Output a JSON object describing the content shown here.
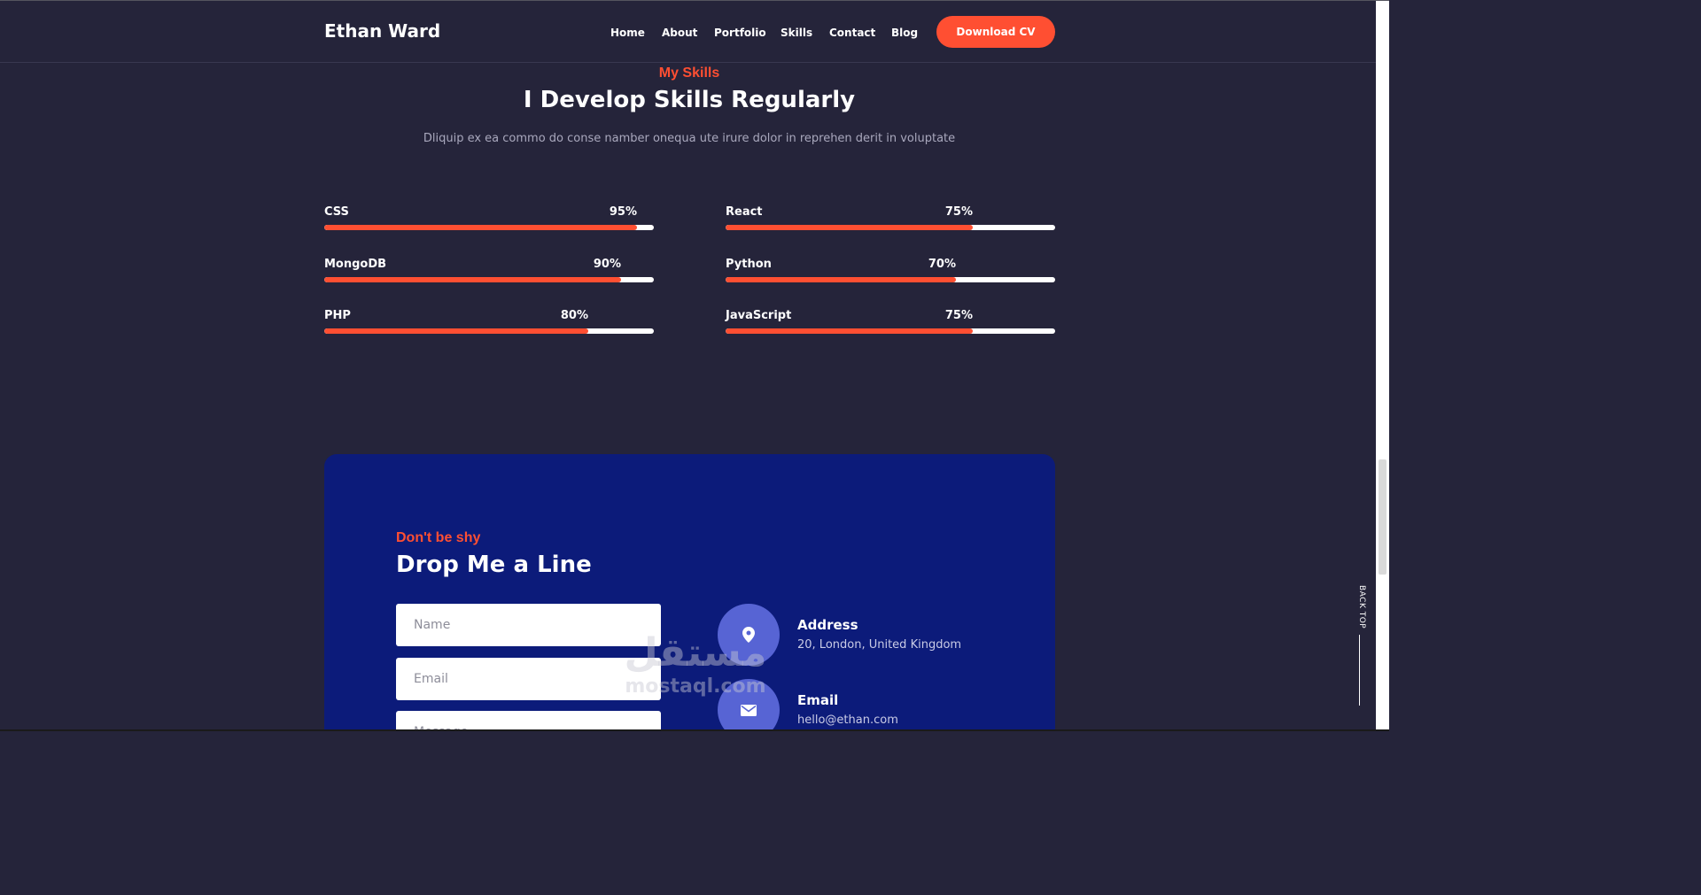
{
  "header": {
    "logo": "Ethan Ward",
    "nav": [
      {
        "label": "Home"
      },
      {
        "label": "About"
      },
      {
        "label": "Portfolio"
      },
      {
        "label": "Skills"
      },
      {
        "label": "Contact"
      },
      {
        "label": "Blog"
      }
    ],
    "cta_label": "Download CV"
  },
  "skills": {
    "eyebrow": "My Skills",
    "title": "I Develop Skills Regularly",
    "subtitle": "Dliquip ex ea commo do conse namber onequa ute irure dolor in reprehen derit in voluptate",
    "items": [
      {
        "name": "CSS",
        "percent_label": "95%",
        "percent": 95
      },
      {
        "name": "React",
        "percent_label": "75%",
        "percent": 75
      },
      {
        "name": "MongoDB",
        "percent_label": "90%",
        "percent": 90
      },
      {
        "name": "Python",
        "percent_label": "70%",
        "percent": 70
      },
      {
        "name": "PHP",
        "percent_label": "80%",
        "percent": 80
      },
      {
        "name": "JavaScript",
        "percent_label": "75%",
        "percent": 75
      }
    ]
  },
  "contact": {
    "eyebrow": "Don't be shy",
    "title": "Drop Me a Line",
    "name_placeholder": "Name",
    "email_placeholder": "Email",
    "message_placeholder": "Message",
    "address_title": "Address",
    "address_text": "20, London, United Kingdom",
    "email_title": "Email",
    "email_text": "hello@ethan.com"
  },
  "back_top": "BACK TOP",
  "watermark": {
    "arabic": "مستقل",
    "latin": "mostaql.com"
  },
  "colors": {
    "background": "#25243a",
    "accent": "#ff4f32",
    "card": "#0c1b7a",
    "circle": "#5764d4"
  }
}
